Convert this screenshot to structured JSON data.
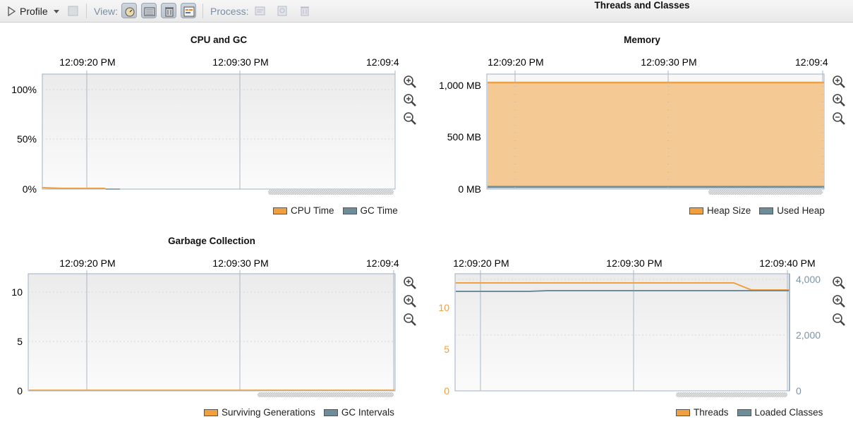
{
  "toolbar": {
    "profile_label": "Profile",
    "view_label": "View:",
    "process_label": "Process:"
  },
  "panels": {
    "cpu": {
      "title": "CPU and GC",
      "time_ticks": [
        "12:09:20 PM",
        "12:09:30 PM",
        "12:09:4"
      ],
      "y_ticks": [
        "100%",
        "50%",
        "0%"
      ],
      "legend": [
        "CPU Time",
        "GC Time"
      ]
    },
    "memory": {
      "title": "Memory",
      "time_ticks": [
        "12:09:20 PM",
        "12:09:30 PM",
        "12:09:4"
      ],
      "y_ticks": [
        "1,000 MB",
        "500 MB",
        "0 MB"
      ],
      "legend": [
        "Heap Size",
        "Used Heap"
      ]
    },
    "gc": {
      "title": "Garbage Collection",
      "time_ticks": [
        "12:09:20 PM",
        "12:09:30 PM",
        "12:09:4"
      ],
      "y_ticks": [
        "10",
        "5",
        "0"
      ],
      "legend": [
        "Surviving Generations",
        "GC Intervals"
      ]
    },
    "threads": {
      "title": "Threads and Classes",
      "time_ticks": [
        "12:09:20 PM",
        "12:09:30 PM",
        "12:09:40 PM"
      ],
      "y_ticks_left": [
        "10",
        "5",
        "0"
      ],
      "y_ticks_right": [
        "4,000",
        "2,000",
        "0"
      ],
      "legend": [
        "Threads",
        "Loaded Classes"
      ]
    }
  },
  "colors": {
    "orange": "#f0a040",
    "orange_fill": "#f5c994",
    "slate": "#6f8c99",
    "axis_blue": "#8aa0b5"
  },
  "chart_data": [
    {
      "type": "line",
      "title": "CPU and GC",
      "ylim": [
        0,
        100
      ],
      "x": [
        "12:09:20 PM",
        "12:09:30 PM"
      ],
      "series": [
        {
          "name": "CPU Time",
          "values": [
            1,
            0
          ]
        },
        {
          "name": "GC Time",
          "values": [
            0,
            0
          ]
        }
      ]
    },
    {
      "type": "area",
      "title": "Memory",
      "ylim": [
        0,
        1100
      ],
      "x": [
        "12:09:20 PM",
        "12:09:30 PM",
        "12:09:40 PM"
      ],
      "series": [
        {
          "name": "Heap Size",
          "values": [
            1020,
            1020,
            1020
          ]
        },
        {
          "name": "Used Heap",
          "values": [
            25,
            25,
            25
          ]
        }
      ]
    },
    {
      "type": "line",
      "title": "Garbage Collection",
      "ylim": [
        0,
        12
      ],
      "x": [
        "12:09:20 PM",
        "12:09:30 PM",
        "12:09:40 PM"
      ],
      "series": [
        {
          "name": "Surviving Generations",
          "values": [
            0,
            0,
            0
          ]
        },
        {
          "name": "GC Intervals",
          "values": [
            0,
            0,
            0
          ]
        }
      ]
    },
    {
      "type": "line",
      "title": "Threads and Classes",
      "ylim": [
        0,
        14
      ],
      "y2lim": [
        0,
        4000
      ],
      "x": [
        "12:09:20 PM",
        "12:09:30 PM",
        "12:09:40 PM"
      ],
      "series": [
        {
          "name": "Threads",
          "axis": "left",
          "values": [
            13,
            13,
            12
          ]
        },
        {
          "name": "Loaded Classes",
          "axis": "right",
          "values": [
            3600,
            3620,
            3620
          ]
        }
      ]
    }
  ]
}
